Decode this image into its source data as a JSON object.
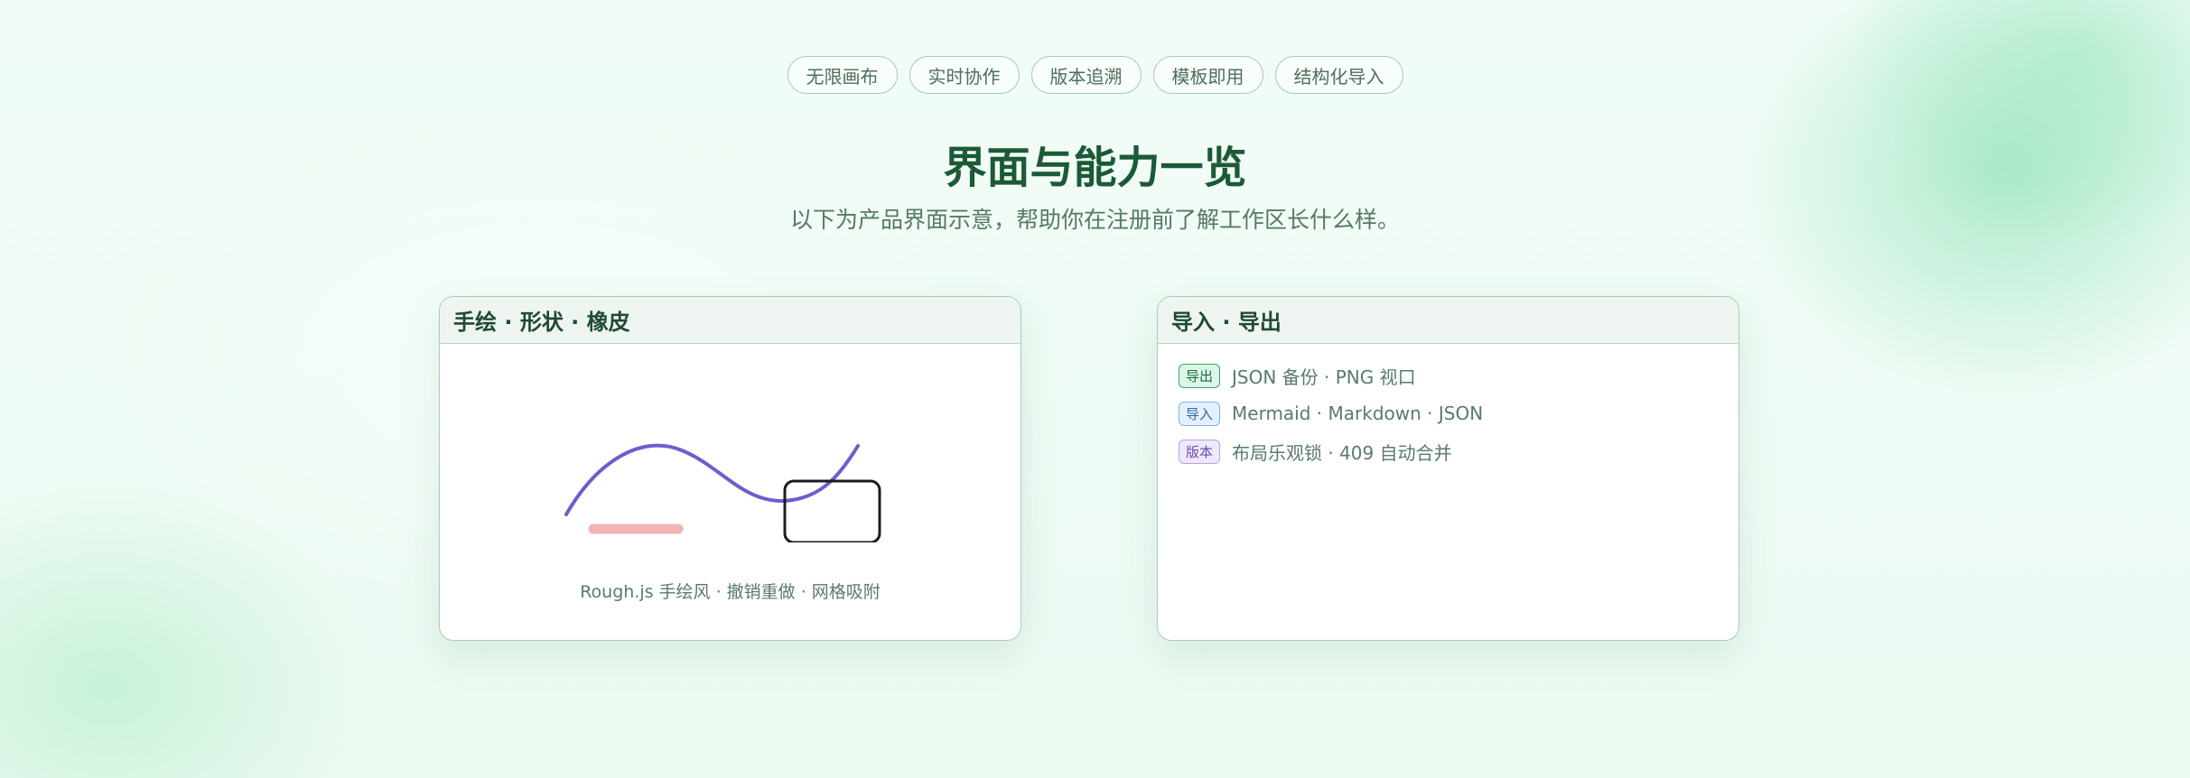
{
  "tags": [
    "无限画布",
    "实时协作",
    "版本追溯",
    "模板即用",
    "结构化导入"
  ],
  "section": {
    "title": "界面与能力一览",
    "subtitle": "以下为产品界面示意，帮助你在注册前了解工作区长什么样。"
  },
  "cards": {
    "sketch": {
      "title": "手绘 · 形状 · 橡皮",
      "caption": "Rough.js 手绘风 · 撤销重做 · 网格吸附"
    },
    "io": {
      "title": "导入 · 导出",
      "rows": [
        {
          "badge": "导出",
          "text": "JSON 备份 · PNG 视口"
        },
        {
          "badge": "导入",
          "text": "Mermaid · Markdown · JSON"
        },
        {
          "badge": "版本",
          "text": "布局乐观锁 · 409 自动合并"
        }
      ]
    }
  },
  "colors": {
    "title": "#1b5a36",
    "stroke_curve": "#6a5fcf",
    "stroke_bar": "#f2b4b4",
    "stroke_rect": "#1c1c1c",
    "badge_export": "#3ea26c",
    "badge_import": "#7cb5e6",
    "badge_version": "#b7a2e4"
  }
}
